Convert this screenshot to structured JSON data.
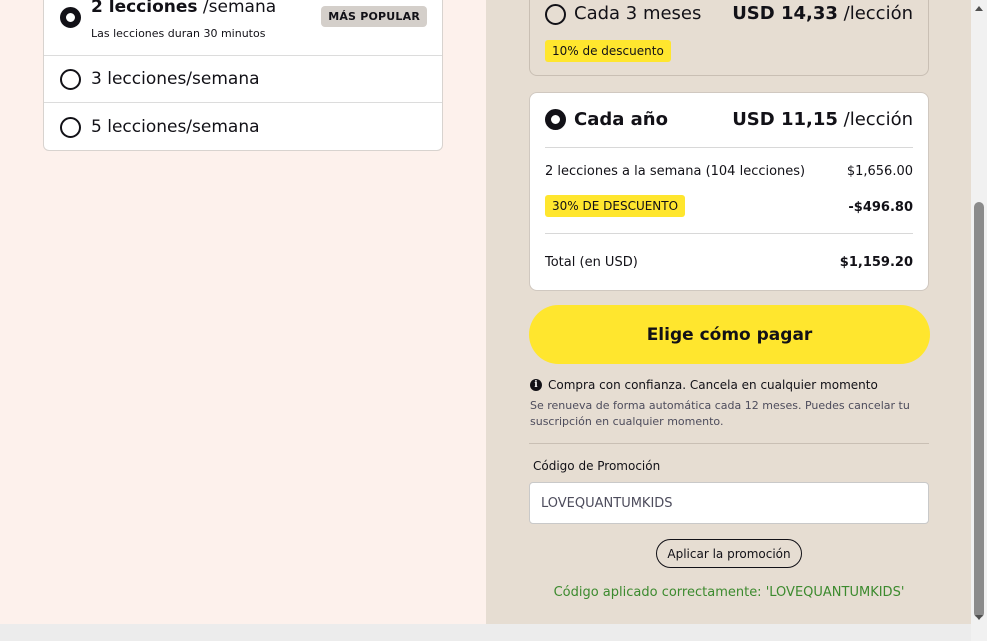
{
  "frequency_options": [
    {
      "label_bold": "2 lecciones",
      "label_rest": " /semana",
      "subtitle": "Las lecciones duran 30 minutos",
      "badge": "MÁS POPULAR",
      "selected": true
    },
    {
      "label": "3 lecciones/semana",
      "selected": false
    },
    {
      "label": "5 lecciones/semana",
      "selected": false
    }
  ],
  "plans": {
    "quarterly": {
      "title": "Cada 3 meses",
      "price": "USD 14,33",
      "unit": " /lección",
      "discount_tag": "10% de descuento",
      "selected": false
    },
    "yearly": {
      "title": "Cada año",
      "price": "USD 11,15",
      "unit": " /lección",
      "selected": true,
      "line_item_label": "2 lecciones a la semana (104 lecciones)",
      "line_item_value": "$1,656.00",
      "discount_tag": "30% DE DESCUENTO",
      "discount_value": "-$496.80",
      "total_label": "Total (en USD)",
      "total_value": "$1,159.20"
    }
  },
  "pay_button_label": "Elige cómo pagar",
  "confidence_text": "Compra con confianza. Cancela en cualquier momento",
  "renew_text": "Se renueva de forma automática cada 12 meses. Puedes cancelar tu suscripción en cualquier momento.",
  "promo": {
    "label": "Código de Promoción",
    "value": "LOVEQUANTUMKIDS",
    "apply_label": "Aplicar la promoción",
    "success_message": "Código aplicado correctamente: 'LOVEQUANTUMKIDS'"
  },
  "colors": {
    "accent_yellow": "#ffe62e",
    "success_green": "#3c8a2e",
    "left_bg": "#fdf1ec",
    "right_bg": "#e6ddd2"
  },
  "icons": {
    "info": "info-circle-icon",
    "radio_selected": "radio-selected-icon",
    "radio_unselected": "radio-unselected-icon"
  }
}
